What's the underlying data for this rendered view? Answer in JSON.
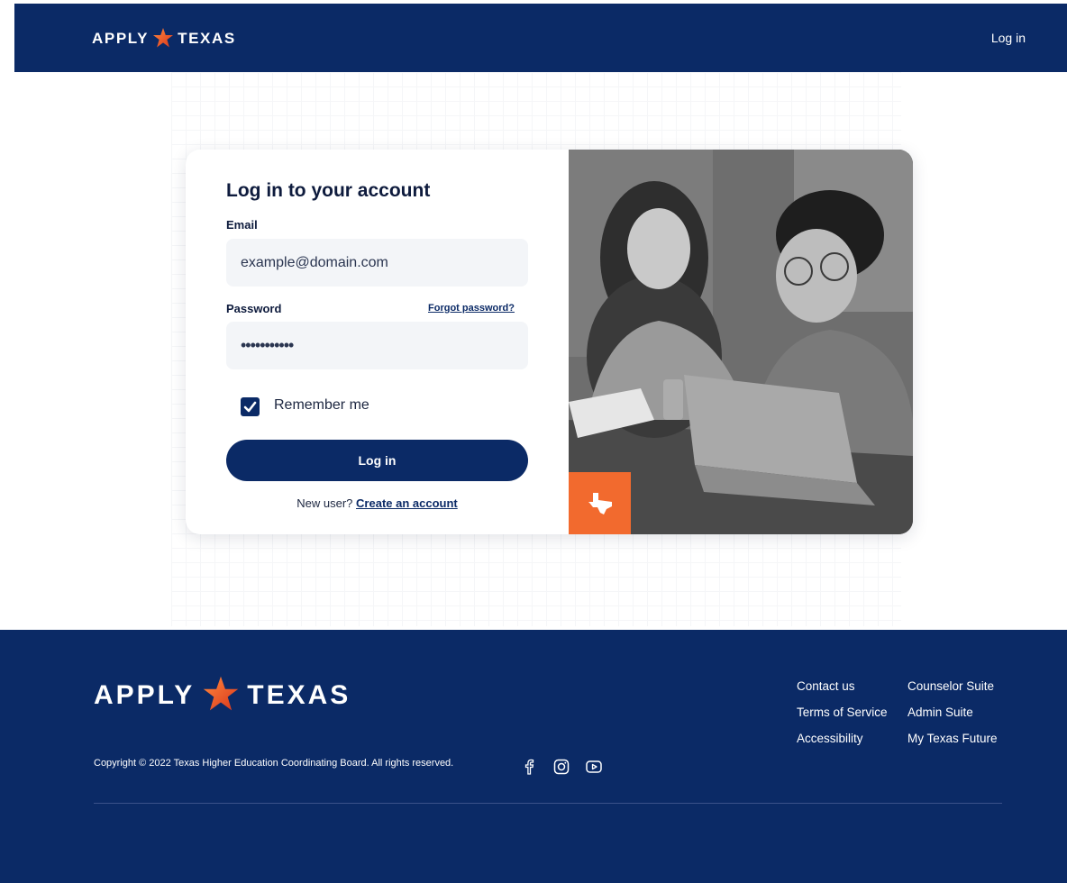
{
  "header": {
    "logo_left": "APPLY",
    "logo_right": "TEXAS",
    "login_link": "Log in"
  },
  "form": {
    "title": "Log in to your account",
    "email_label": "Email",
    "email_value": "example@domain.com",
    "password_label": "Password",
    "forgot_link": "Forgot password?",
    "password_value": "•••••••••••",
    "remember_label": "Remember me",
    "remember_checked": true,
    "login_button": "Log in",
    "new_user_text": "New user?",
    "create_account_link": "Create an account"
  },
  "footer": {
    "logo_left": "APPLY",
    "logo_right": "TEXAS",
    "links_col1": [
      "Contact us",
      "Terms of Service",
      "Accessibility"
    ],
    "links_col2": [
      "Counselor Suite",
      "Admin Suite",
      "My Texas Future"
    ],
    "copyright": "Copyright © 2022 Texas Higher Education Coordinating Board. All rights reserved.",
    "social": [
      "facebook-icon",
      "instagram-icon",
      "youtube-icon"
    ]
  },
  "colors": {
    "navy": "#0b2a66",
    "orange": "#f26a2e",
    "input_bg": "#f3f5f8"
  }
}
